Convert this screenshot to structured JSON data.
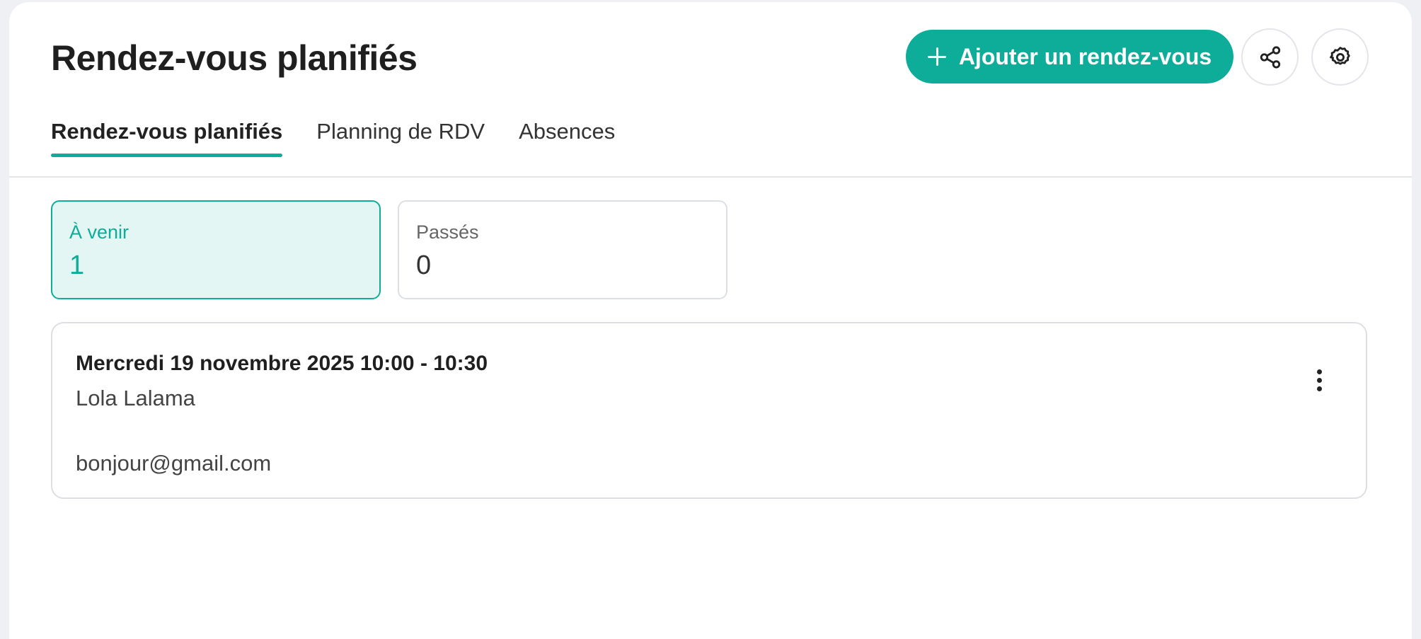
{
  "header": {
    "title": "Rendez-vous planifiés",
    "add_button_label": "Ajouter un rendez-vous",
    "share_icon": "share-icon",
    "settings_icon": "gear-icon"
  },
  "tabs": [
    {
      "label": "Rendez-vous planifiés",
      "active": true
    },
    {
      "label": "Planning de RDV",
      "active": false
    },
    {
      "label": "Absences",
      "active": false
    }
  ],
  "stats": {
    "upcoming": {
      "label": "À venir",
      "value": "1"
    },
    "past": {
      "label": "Passés",
      "value": "0"
    }
  },
  "appointments": [
    {
      "datetime": "Mercredi 19 novembre 2025 10:00 - 10:30",
      "name": "Lola Lalama",
      "email": "bonjour@gmail.com"
    }
  ],
  "colors": {
    "accent": "#0ead99",
    "accent_light": "#e3f6f3",
    "border": "#dcdfe4",
    "background": "#eef0f4"
  }
}
